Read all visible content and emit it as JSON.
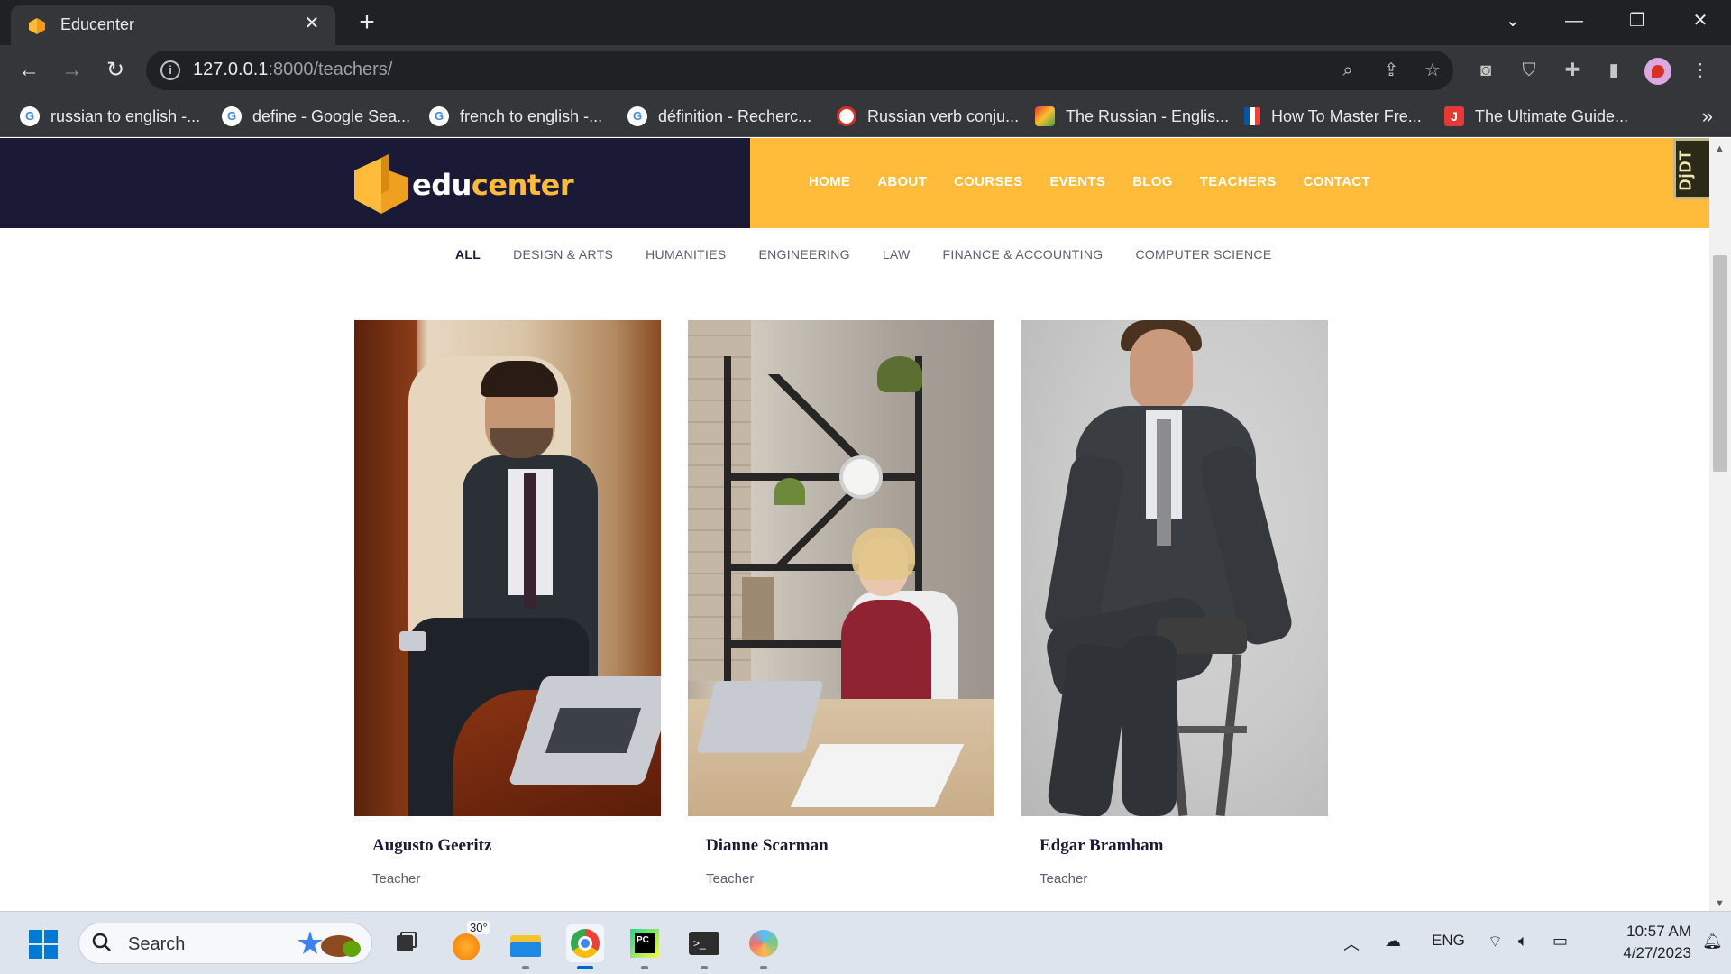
{
  "browser": {
    "tab_title": "Educenter",
    "url_host": "127.0.0.1",
    "url_path": ":8000/teachers/",
    "bookmarks": [
      {
        "label": "russian to english -...",
        "icon": "google-icon"
      },
      {
        "label": "define - Google Sea...",
        "icon": "google-icon"
      },
      {
        "label": "french to english -...",
        "icon": "google-icon"
      },
      {
        "label": "définition - Recherc...",
        "icon": "google-icon"
      },
      {
        "label": "Russian verb conju...",
        "icon": "reverso-icon"
      },
      {
        "label": "The Russian - Englis...",
        "icon": "paint-icon"
      },
      {
        "label": "How To Master Fre...",
        "icon": "french-flag-icon"
      },
      {
        "label": "The Ultimate Guide...",
        "icon": "j-icon"
      }
    ]
  },
  "site": {
    "logo_prefix": "edu",
    "logo_suffix": "center",
    "nav": [
      "HOME",
      "ABOUT",
      "COURSES",
      "EVENTS",
      "BLOG",
      "TEACHERS",
      "CONTACT"
    ],
    "debug_toolbar_label": "DjDT",
    "filters": [
      "ALL",
      "DESIGN & ARTS",
      "HUMANITIES",
      "ENGINEERING",
      "LAW",
      "FINANCE & ACCOUNTING",
      "COMPUTER SCIENCE"
    ],
    "active_filter": "ALL",
    "teachers": [
      {
        "name": "Augusto Geeritz",
        "role": "Teacher"
      },
      {
        "name": "Dianne Scarman",
        "role": "Teacher"
      },
      {
        "name": "Edgar Bramham",
        "role": "Teacher"
      }
    ],
    "colors": {
      "navy": "#1a1a37",
      "accent": "#ffbc3b"
    }
  },
  "taskbar": {
    "search_label": "Search",
    "weather_temp": "30°",
    "language": "ENG",
    "time": "10:57 AM",
    "date": "4/27/2023"
  }
}
